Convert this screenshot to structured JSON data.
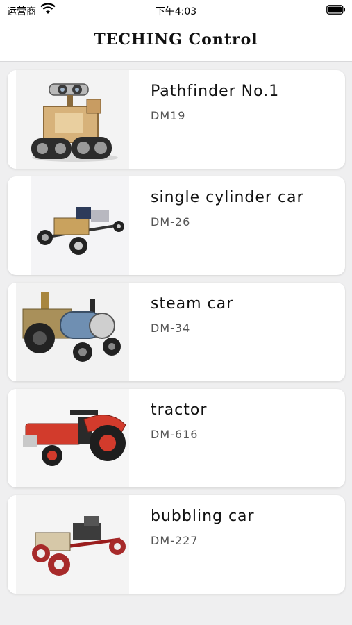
{
  "status_bar": {
    "carrier": "运营商",
    "time": "下午4:03"
  },
  "nav": {
    "title": "TECHING Control"
  },
  "items": [
    {
      "name": "Pathfinder No.1",
      "code": "DM19",
      "image": "robot-kit-image"
    },
    {
      "name": "single cylinder car",
      "code": "DM-26",
      "image": "single-cylinder-car-image"
    },
    {
      "name": "steam car",
      "code": "DM-34",
      "image": "steam-car-image"
    },
    {
      "name": "tractor",
      "code": "DM-616",
      "image": "tractor-image"
    },
    {
      "name": "bubbling car",
      "code": "DM-227",
      "image": "bubbling-car-image"
    }
  ]
}
